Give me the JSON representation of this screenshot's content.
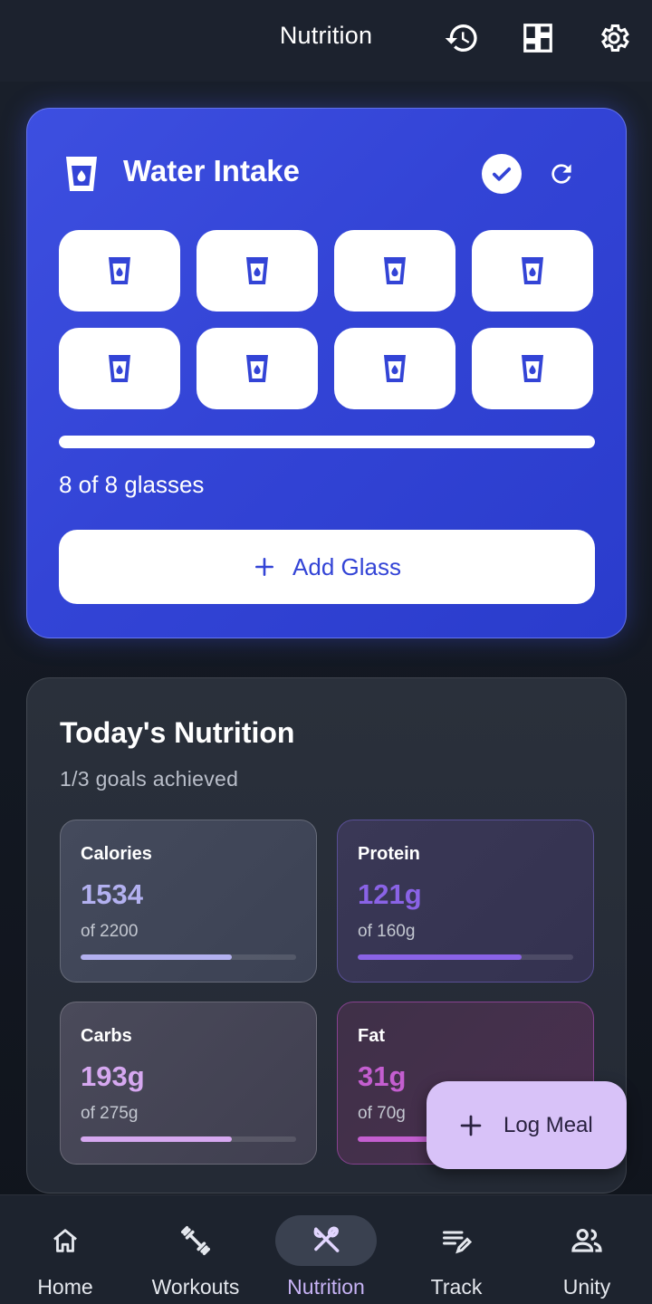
{
  "header": {
    "title": "Nutrition",
    "icons": [
      "history-icon",
      "dashboard-icon",
      "settings-gear-icon"
    ]
  },
  "water": {
    "title": "Water Intake",
    "glasses_filled": 8,
    "glasses_total": 8,
    "progress": 1.0,
    "count_text": "8 of 8 glasses",
    "add_label": "Add Glass",
    "accent": "#3344d6"
  },
  "nutrition": {
    "title": "Today's Nutrition",
    "subtitle": "1/3 goals achieved",
    "macros": [
      {
        "label": "Calories",
        "value": "1534",
        "goal": "of 2200",
        "progress": 0.7,
        "color": "#b3b1f0"
      },
      {
        "label": "Protein",
        "value": "121g",
        "goal": "of 160g",
        "progress": 0.76,
        "color": "#8a63e6"
      },
      {
        "label": "Carbs",
        "value": "193g",
        "goal": "of 275g",
        "progress": 0.7,
        "color": "#d6a8f0"
      },
      {
        "label": "Fat",
        "value": "31g",
        "goal": "of 70g",
        "progress": 0.44,
        "color": "#c45ed0"
      }
    ]
  },
  "fab": {
    "label": "Log Meal"
  },
  "bottom_nav": {
    "items": [
      {
        "label": "Home",
        "icon": "home-icon"
      },
      {
        "label": "Workouts",
        "icon": "dumbbell-icon"
      },
      {
        "label": "Nutrition",
        "icon": "utensils-icon",
        "active": true
      },
      {
        "label": "Track",
        "icon": "edit-list-icon"
      },
      {
        "label": "Unity",
        "icon": "people-icon"
      }
    ]
  }
}
